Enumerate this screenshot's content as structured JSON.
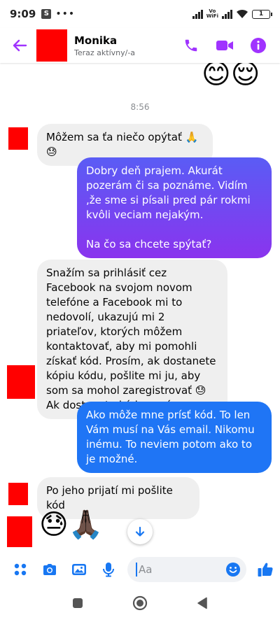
{
  "status_bar": {
    "time": "9:09",
    "app_badge": "S",
    "dots": "•••",
    "vowifi_top": "Vo",
    "vowifi_bottom": "WiFi",
    "battery": "1"
  },
  "header": {
    "contact_name": "Monika",
    "contact_status": "Teraz aktívny/-a",
    "icons": [
      "back-arrow-icon",
      "phone-icon",
      "video-camera-icon",
      "info-icon"
    ],
    "accent_color": "#a033ff"
  },
  "chat": {
    "top_emojis": "😊😌",
    "timestamp": "8:56",
    "messages": [
      {
        "direction": "incoming",
        "text": "Môžem sa ťa niečo opýtať 🙏😓"
      },
      {
        "direction": "outgoing",
        "text": "Dobry deň prajem. Akurát pozerám či sa poznáme. Vidím ,že sme si písali pred pár rokmi kvôli veciam nejakým.\n\nNa čo sa chcete spýtať?"
      },
      {
        "direction": "incoming",
        "text": "Snažím sa prihlásiť cez Facebook na svojom novom telefóne a Facebook mi to nedovolí, ukazujú mi 2 priateľov, ktorých môžem kontaktovať, aby mi pomohli získať kód. Prosím, ak dostanete kópiu kódu, pošlite mi ju, aby som sa mohol zaregistrovať 😓 Ak dostanete kód, prosím"
      },
      {
        "direction": "outgoing",
        "text": "Ako môže mne prísť kód. To len Vám musí na Vás email. Nikomu inému.  To neviem potom ako to je možné."
      },
      {
        "direction": "incoming",
        "text": "Po jeho prijatí mi pošlite kód"
      },
      {
        "direction": "incoming",
        "text": "😓🙏🏿"
      }
    ],
    "outgoing_gradient": [
      "#5a5cf5",
      "#8a34ee"
    ],
    "outgoing_solid": "#1f75f5"
  },
  "composer": {
    "placeholder": "Aa",
    "icons": [
      "apps-grid-icon",
      "camera-icon",
      "gallery-icon",
      "microphone-icon",
      "emoji-icon",
      "thumbs-up-icon"
    ],
    "icon_color": "#1877f2"
  },
  "nav_bar": {
    "icons": [
      "recents-square-icon",
      "home-circle-icon",
      "back-triangle-icon"
    ]
  }
}
